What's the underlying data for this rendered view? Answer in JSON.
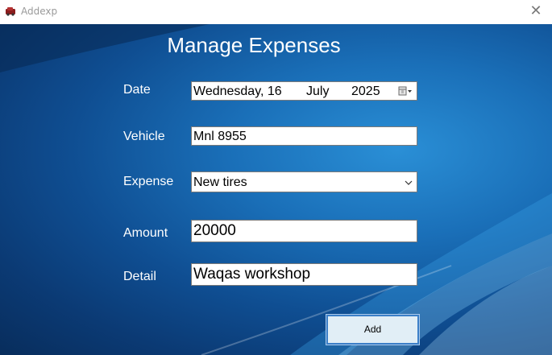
{
  "window": {
    "title": "Addexp",
    "close_glyph": "✕"
  },
  "form": {
    "heading": "Manage Expenses",
    "date": {
      "label": "Date",
      "weekday": "Wednesday, 16",
      "month": "July",
      "year": "2025"
    },
    "vehicle": {
      "label": "Vehicle",
      "value": "Mnl 8955"
    },
    "expense": {
      "label": "Expense",
      "value": "New tires"
    },
    "amount": {
      "label": "Amount",
      "value": "20000"
    },
    "detail": {
      "label": "Detail",
      "value": "Waqas workshop"
    },
    "add_label": "Add"
  },
  "icons": {
    "app": "app-icon",
    "calendar": "calendar-dropdown-icon",
    "dropdown": "chevron-down-icon"
  },
  "colors": {
    "background": "#0f4e92",
    "button_face": "#e1eef6",
    "button_border": "#3c7fc8"
  }
}
